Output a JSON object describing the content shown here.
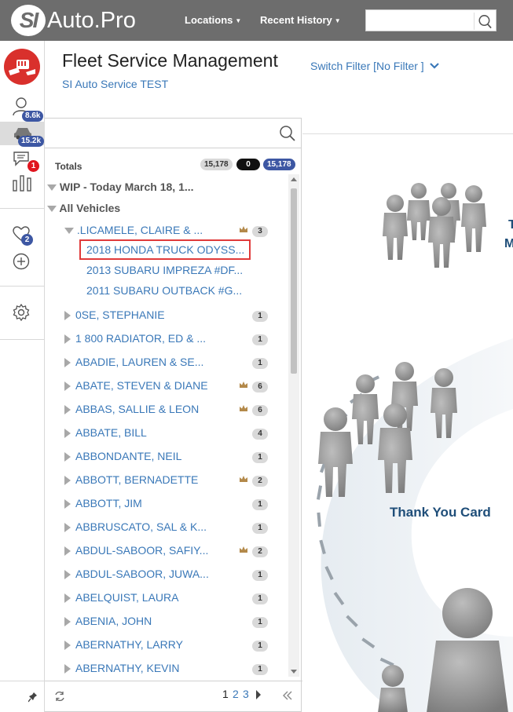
{
  "brand": {
    "si": "SI",
    "name": "Auto.Pro"
  },
  "topnav": {
    "locations": "Locations",
    "recent_history": "Recent History",
    "search_placeholder": ""
  },
  "rail": {
    "customers_badge": "8.6k",
    "vehicles_badge": "15.2k",
    "messages_badge": "1",
    "favorites_badge": "2"
  },
  "header": {
    "title": "Fleet Service Management",
    "subtitle": "SI Auto Service TEST",
    "switch_filter": "Switch Filter [No Filter ]"
  },
  "panel": {
    "search_placeholder": "",
    "totals_label": "Totals",
    "totals": [
      "15,178",
      "0",
      "15,178"
    ],
    "wip_label": "WIP - Today March 18, 1...",
    "all_vehicles_label": "All Vehicles",
    "expanded_customer": {
      "name": ".LICAMELE, CLAIRE & ...",
      "count": "3"
    },
    "vehicles": [
      "2018 HONDA TRUCK ODYSS...",
      "2013 SUBARU IMPREZA #DF...",
      "2011 SUBARU OUTBACK #G..."
    ],
    "customers": [
      {
        "name": "0SE, STEPHANIE",
        "count": "1",
        "crown": false
      },
      {
        "name": "1 800 RADIATOR, ED & ...",
        "count": "1",
        "crown": false
      },
      {
        "name": "ABADIE, LAUREN & SE...",
        "count": "1",
        "crown": false
      },
      {
        "name": "ABATE, STEVEN & DIANE",
        "count": "6",
        "crown": true
      },
      {
        "name": "ABBAS, SALLIE & LEON",
        "count": "6",
        "crown": true
      },
      {
        "name": "ABBATE, BILL",
        "count": "4",
        "crown": false
      },
      {
        "name": "ABBONDANTE, NEIL",
        "count": "1",
        "crown": false
      },
      {
        "name": "ABBOTT, BERNADETTE",
        "count": "2",
        "crown": true
      },
      {
        "name": "ABBOTT, JIM",
        "count": "1",
        "crown": false
      },
      {
        "name": "ABBRUSCATO, SAL & K...",
        "count": "1",
        "crown": false
      },
      {
        "name": "ABDUL-SABOOR, SAFIY...",
        "count": "2",
        "crown": true
      },
      {
        "name": "ABDUL-SABOOR, JUWA...",
        "count": "1",
        "crown": false
      },
      {
        "name": "ABELQUIST, LAURA",
        "count": "1",
        "crown": false
      },
      {
        "name": "ABENIA, JOHN",
        "count": "1",
        "crown": false
      },
      {
        "name": "ABERNATHY, LARRY",
        "count": "1",
        "crown": false
      },
      {
        "name": "ABERNATHY, KEVIN",
        "count": "1",
        "crown": false
      }
    ],
    "pages": [
      "1",
      "2",
      "3"
    ],
    "current_page": "1"
  },
  "illustration": {
    "caption": "Thank You Card",
    "edge_letters": [
      "T",
      "M"
    ]
  },
  "colors": {
    "topbar": "#6d6d6d",
    "link": "#3a78b8",
    "badge_blue": "#3d57a3",
    "badge_red": "#e0141e",
    "highlight": "#e03a3a",
    "caption": "#1f4e79"
  }
}
